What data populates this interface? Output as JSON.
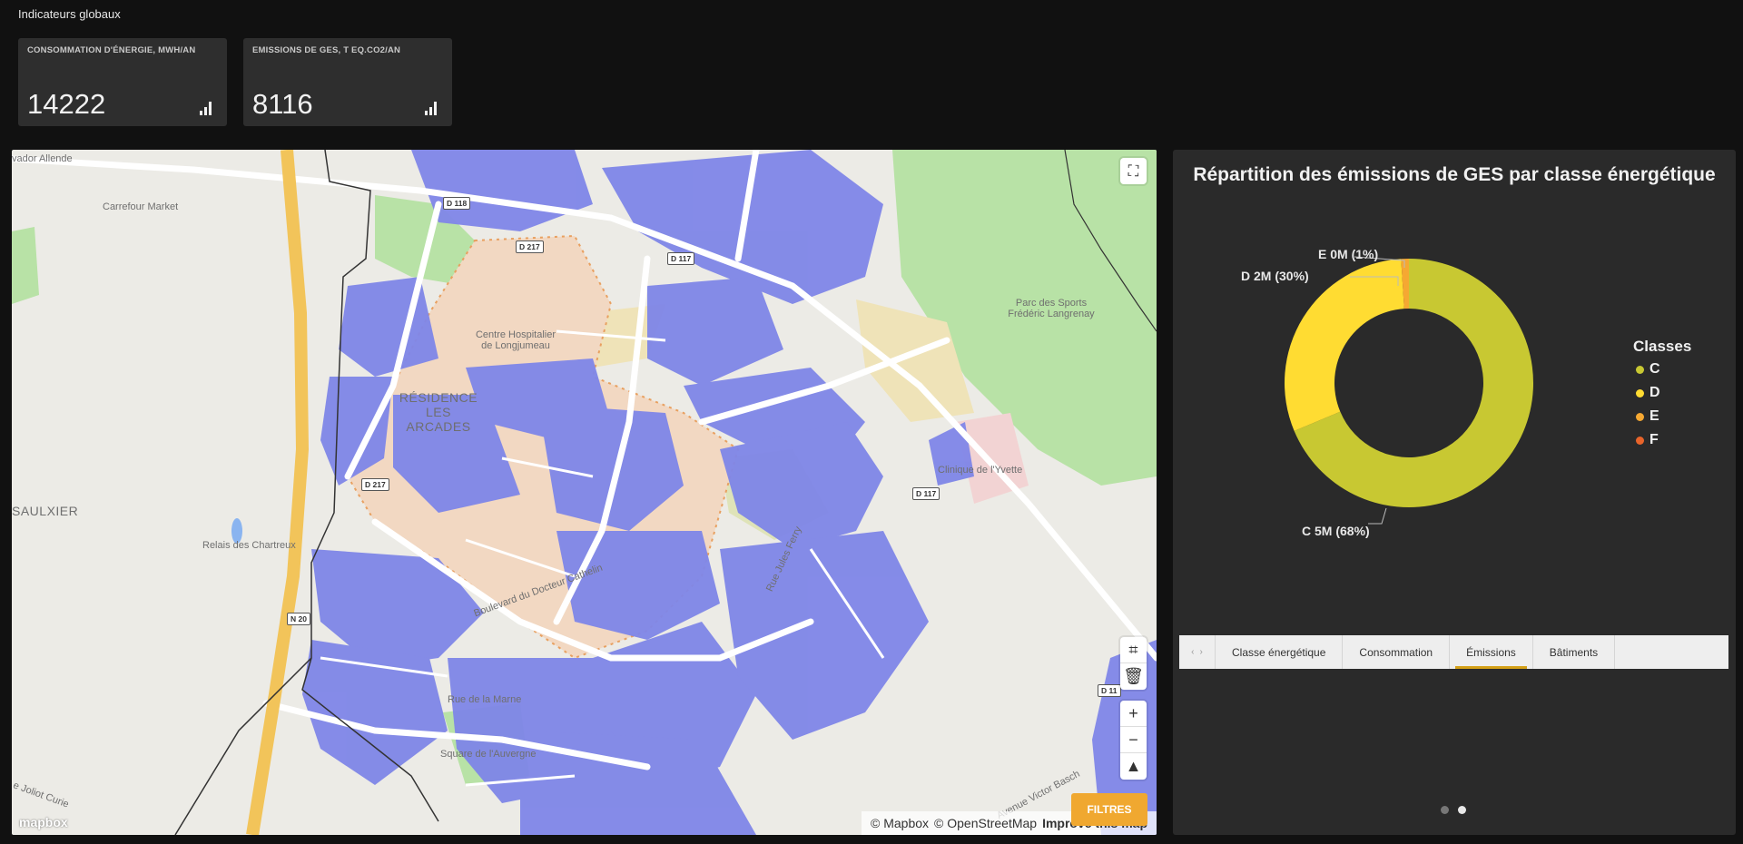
{
  "page": {
    "title": "Indicateurs globaux"
  },
  "kpis": [
    {
      "label": "CONSOMMATION D'ÉNERGIE, MWH/AN",
      "value": "14222",
      "icon": "bar-chart-icon"
    },
    {
      "label": "EMISSIONS DE GES, T EQ.CO2/AN",
      "value": "8116",
      "icon": "bar-chart-icon"
    }
  ],
  "map": {
    "labels": {
      "allende": "vador Allende",
      "carrefour": "Carrefour Market",
      "hospital": "Centre Hospitalier de Longjumeau",
      "residence": "RÉSIDENCE LES ARCADES",
      "parc": "Parc des Sports Frédéric Langrenay",
      "clinique": "Clinique de l'Yvette",
      "saulxier": "SAULXIER",
      "relais": "Relais des Chartreux",
      "square": "Square de l'Auvergne",
      "marne": "Rue de la Marne",
      "boulevard": "Boulevard du Docteur Cathelin",
      "victor": "Avenue Victor Basch",
      "curie": "e Joliot Curie",
      "ferry": "Rue Jules Ferry"
    },
    "road_badges": {
      "d118": "D 118",
      "d217a": "D 217",
      "d117a": "D 117",
      "d217b": "D 217",
      "d117b": "D 117",
      "n20": "N 20",
      "d11": "D 11"
    },
    "controls": {
      "fullscreen_icon": "fullscreen-icon",
      "draw_icon": "polygon-draw-icon",
      "trash_icon": "trash-icon",
      "zoom_in": "+",
      "zoom_out": "−",
      "compass_icon": "compass-icon"
    },
    "attribution": {
      "mapbox": "© Mapbox",
      "osm": "© OpenStreetMap",
      "improve": "Improve this map"
    },
    "logo": "mapbox",
    "filters_label": "FILTRES",
    "colors": {
      "building": "#7f86e8",
      "park": "#b8e2a6",
      "zone": "#f2d8c2",
      "major_road": "#f2c45a"
    }
  },
  "chart_data": {
    "type": "pie",
    "title": "Répartition des émissions de GES par classe énergétique",
    "categories": [
      "C",
      "D",
      "E",
      "F"
    ],
    "values": [
      68,
      30,
      1,
      0
    ],
    "display_labels": [
      "C 5M (68%)",
      "D 2M (30%)",
      "E 0M (1%)",
      "F"
    ],
    "colors": [
      "#c8c832",
      "#ffdc32",
      "#f5a832",
      "#e8642a"
    ],
    "legend": {
      "title": "Classes",
      "position": "right"
    },
    "donut": true
  },
  "tabs": {
    "items": [
      "Classe énergétique",
      "Consommation",
      "Émissions",
      "Bâtiments"
    ],
    "active": "Émissions"
  },
  "pager": {
    "pages": 2,
    "current": 2
  }
}
